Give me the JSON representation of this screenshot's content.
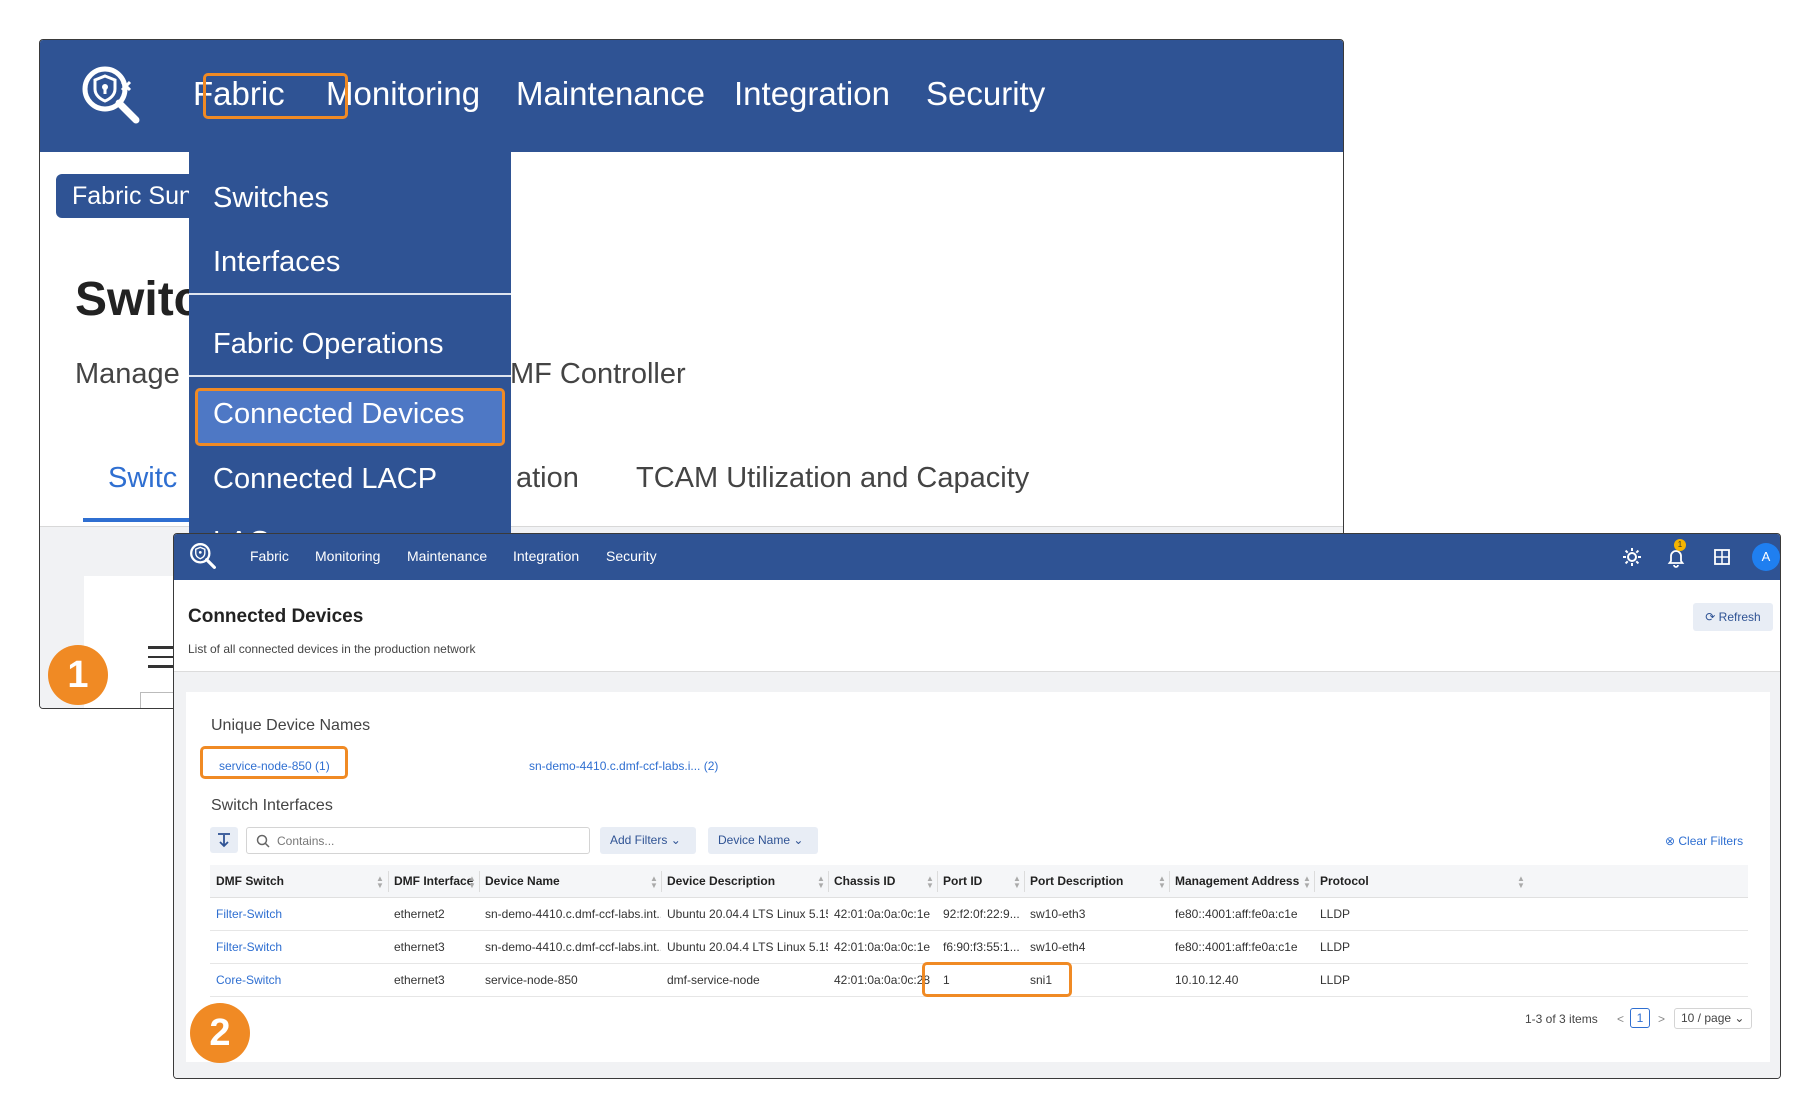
{
  "colors": {
    "nav": "#2f5394",
    "accent": "#f08a24",
    "link": "#2f6fd1"
  },
  "step_badges": [
    "1",
    "2"
  ],
  "shot1": {
    "nav": [
      "Fabric",
      "Monitoring",
      "Maintenance",
      "Integration",
      "Security"
    ],
    "chip": "Fabric Sun",
    "title": "Switc",
    "subtitle_left": "Manage",
    "subtitle_right": "MF Controller",
    "tabs": [
      "Switc",
      "ation",
      "TCAM Utilization and Capacity"
    ],
    "dropdown": {
      "items": [
        "Switches",
        "Interfaces",
        "Fabric Operations",
        "Connected Devices",
        "Connected LACP",
        "LAG"
      ],
      "selected": "Connected Devices"
    }
  },
  "shot2": {
    "nav": [
      "Fabric",
      "Monitoring",
      "Maintenance",
      "Integration",
      "Security"
    ],
    "icons": [
      "gear-icon",
      "bell-icon",
      "grid-icon"
    ],
    "notification_count": "1",
    "avatar": "A",
    "title": "Connected Devices",
    "subtitle": "List of all connected devices in the production network",
    "refresh": "Refresh",
    "unique_device_names": {
      "label": "Unique Device Names",
      "items": [
        "service-node-850 (1)",
        "sn-demo-4410.c.dmf-ccf-labs.i...  (2)"
      ]
    },
    "switch_interfaces": {
      "label": "Switch Interfaces",
      "search_placeholder": "Contains...",
      "add_filters": "Add Filters",
      "device_name_filter": "Device Name",
      "clear_filters": "Clear Filters"
    },
    "table": {
      "columns": [
        "DMF Switch",
        "DMF Interface",
        "Device Name",
        "Device Description",
        "Chassis ID",
        "Port ID",
        "Port Description",
        "Management Address",
        "Protocol"
      ],
      "rows": [
        [
          "Filter-Switch",
          "ethernet2",
          "sn-demo-4410.c.dmf-ccf-labs.int...",
          "Ubuntu 20.04.4 LTS Linux 5.15...",
          "42:01:0a:0a:0c:1e",
          "92:f2:0f:22:9...",
          "sw10-eth3",
          "fe80::4001:aff:fe0a:c1e",
          "LLDP"
        ],
        [
          "Filter-Switch",
          "ethernet3",
          "sn-demo-4410.c.dmf-ccf-labs.int...",
          "Ubuntu 20.04.4 LTS Linux 5.15...",
          "42:01:0a:0a:0c:1e",
          "f6:90:f3:55:1...",
          "sw10-eth4",
          "fe80::4001:aff:fe0a:c1e",
          "LLDP"
        ],
        [
          "Core-Switch",
          "ethernet3",
          "service-node-850",
          "dmf-service-node",
          "42:01:0a:0a:0c:28",
          "1",
          "sni1",
          "10.10.12.40",
          "LLDP"
        ]
      ]
    },
    "pagination": {
      "summary": "1-3 of 3 items",
      "prev": "<",
      "page": "1",
      "next": ">",
      "page_size": "10 / page"
    }
  }
}
